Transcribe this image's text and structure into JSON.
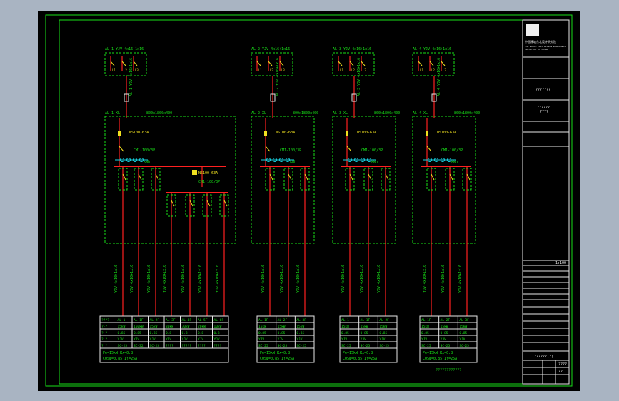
{
  "title_block": {
    "company": "中国建筑东北设计研究院",
    "company_en": "THE NORTH EAST DESIGN & RESEARCH",
    "company_en2": "INSTITUTE OF CHINA",
    "project_label": "???????",
    "drawing_label": "??????",
    "sub_label": "????",
    "scale_label": "1:100",
    "date_label": "????",
    "sheet_no": "??",
    "drawing_no": "??????(?)"
  },
  "tables": [
    {
      "rows": [
        [
          "????",
          "AL-1",
          "AL-1F",
          "AL-2F",
          "AL-3F",
          "AL-4F",
          "AL-5F",
          "AL-6F"
        ],
        [
          "?-?",
          "15kW",
          "150kW",
          "15kW",
          "30kW",
          "30kW",
          "20kW",
          "10kW"
        ],
        [
          "?-?",
          "0.85",
          "0.85",
          "0.85",
          "0.8",
          "0.8",
          "0.8",
          "0.8"
        ],
        [
          "? ?",
          "YJV",
          "YJV",
          "YJV",
          "YJV",
          "YJV",
          "YJV",
          "YJV"
        ],
        [
          "? ?",
          "SC-25",
          "SC-32",
          "SC-25",
          "????",
          "?????",
          "????",
          "????"
        ]
      ],
      "summary1": "Pe=15kW    Kx=0.8",
      "summary2": "COSφ=0.85  Ij=25A"
    },
    {
      "rows": [
        [
          "AL-1F",
          "AL-2F",
          "AL-3F"
        ],
        [
          "15kW",
          "15kW",
          "15kW"
        ],
        [
          "0.85",
          "0.85",
          "0.85"
        ],
        [
          "YJV",
          "YJV",
          "YJV"
        ],
        [
          "SC-25",
          "SC-25",
          "SC-25"
        ]
      ],
      "summary1": "Pe=15kW  Kx=0.8",
      "summary2": "COSφ=0.85  Ij=25A"
    },
    {
      "rows": [
        [
          "AL-1",
          "AL-1F",
          "AL-2F"
        ],
        [
          "15kW",
          "15kW",
          "15kW"
        ],
        [
          "0.85",
          "0.85",
          "0.85"
        ],
        [
          "YJV",
          "YJV",
          "YJV"
        ],
        [
          "SC-25",
          "SC-25",
          "SC-25"
        ]
      ],
      "summary1": "Pe=15kW  Kx=0.8",
      "summary2": "COSφ=0.85  Ij=25A"
    },
    {
      "rows": [
        [
          "AL-1F",
          "AL-2F",
          "AL-3F"
        ],
        [
          "15kW",
          "15kW",
          "15kW"
        ],
        [
          "0.85",
          "0.85",
          "0.85"
        ],
        [
          "YJV",
          "YJV",
          "YJV"
        ],
        [
          "SC-25",
          "SC-25",
          "SC-25"
        ]
      ],
      "summary1": "Pe=15kW  Kx=0.8",
      "summary2": "COSφ=0.85  Ij=25A"
    }
  ],
  "panels": [
    {
      "top_label": "AL-1  YJV-4x16+1x16",
      "box_label": "AL-1  XL",
      "dim": "800x1800x400",
      "breaker": "NS100-63A",
      "sub": "CM1-100/3P",
      "meter": "kWh"
    },
    {
      "top_label": "AL-2  YJV-4x16+1x16",
      "box_label": "AL-2  XL",
      "dim": "800x1800x400",
      "breaker": "NS100-63A",
      "sub": "CM1-100/3P",
      "meter": "kWh"
    },
    {
      "top_label": "AL-3  YJV-4x16+1x16",
      "box_label": "AL-3  XL",
      "dim": "800x1800x400",
      "breaker": "NS100-63A",
      "sub": "CM1-100/3P",
      "meter": "kWh"
    },
    {
      "top_label": "AL-4  YJV-4x16+1x16",
      "box_label": "AL-4  XL",
      "dim": "800x1800x400",
      "breaker": "NS100-63A",
      "sub": "CM1-100/3P",
      "meter": "kWh"
    }
  ],
  "note": "????????????",
  "colors": {
    "background": "#a9b4c2",
    "sheet": "#000000",
    "line": "#18e018",
    "bus": "#ff2020",
    "accent": "#f0e020",
    "cyan": "#18d8e8"
  }
}
